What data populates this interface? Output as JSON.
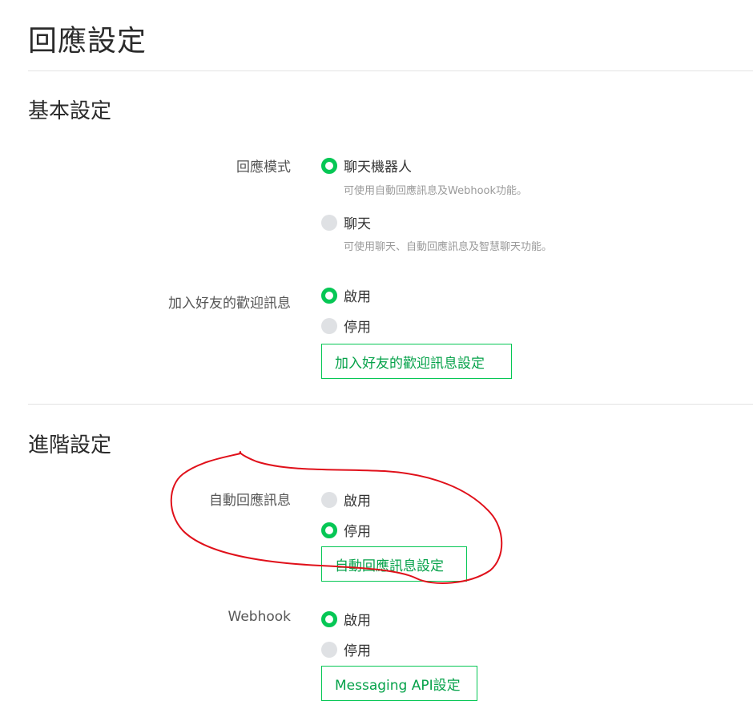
{
  "page": {
    "title": "回應設定"
  },
  "basic": {
    "title": "基本設定",
    "response_mode": {
      "label": "回應模式",
      "options": [
        {
          "label": "聊天機器人",
          "hint": "可使用自動回應訊息及Webhook功能。",
          "selected": true
        },
        {
          "label": "聊天",
          "hint": "可使用聊天、自動回應訊息及智慧聊天功能。",
          "selected": false
        }
      ]
    },
    "welcome": {
      "label": "加入好友的歡迎訊息",
      "options": [
        {
          "label": "啟用",
          "selected": true
        },
        {
          "label": "停用",
          "selected": false
        }
      ],
      "button": "加入好友的歡迎訊息設定"
    }
  },
  "advanced": {
    "title": "進階設定",
    "auto_reply": {
      "label": "自動回應訊息",
      "options": [
        {
          "label": "啟用",
          "selected": false
        },
        {
          "label": "停用",
          "selected": true
        }
      ],
      "button": "自動回應訊息設定"
    },
    "webhook": {
      "label": "Webhook",
      "options": [
        {
          "label": "啟用",
          "selected": true
        },
        {
          "label": "停用",
          "selected": false
        }
      ],
      "button": "Messaging API設定"
    }
  },
  "colors": {
    "accent": "#06c755",
    "annotation": "#e0101a",
    "radio_off": "#dfe1e4"
  }
}
